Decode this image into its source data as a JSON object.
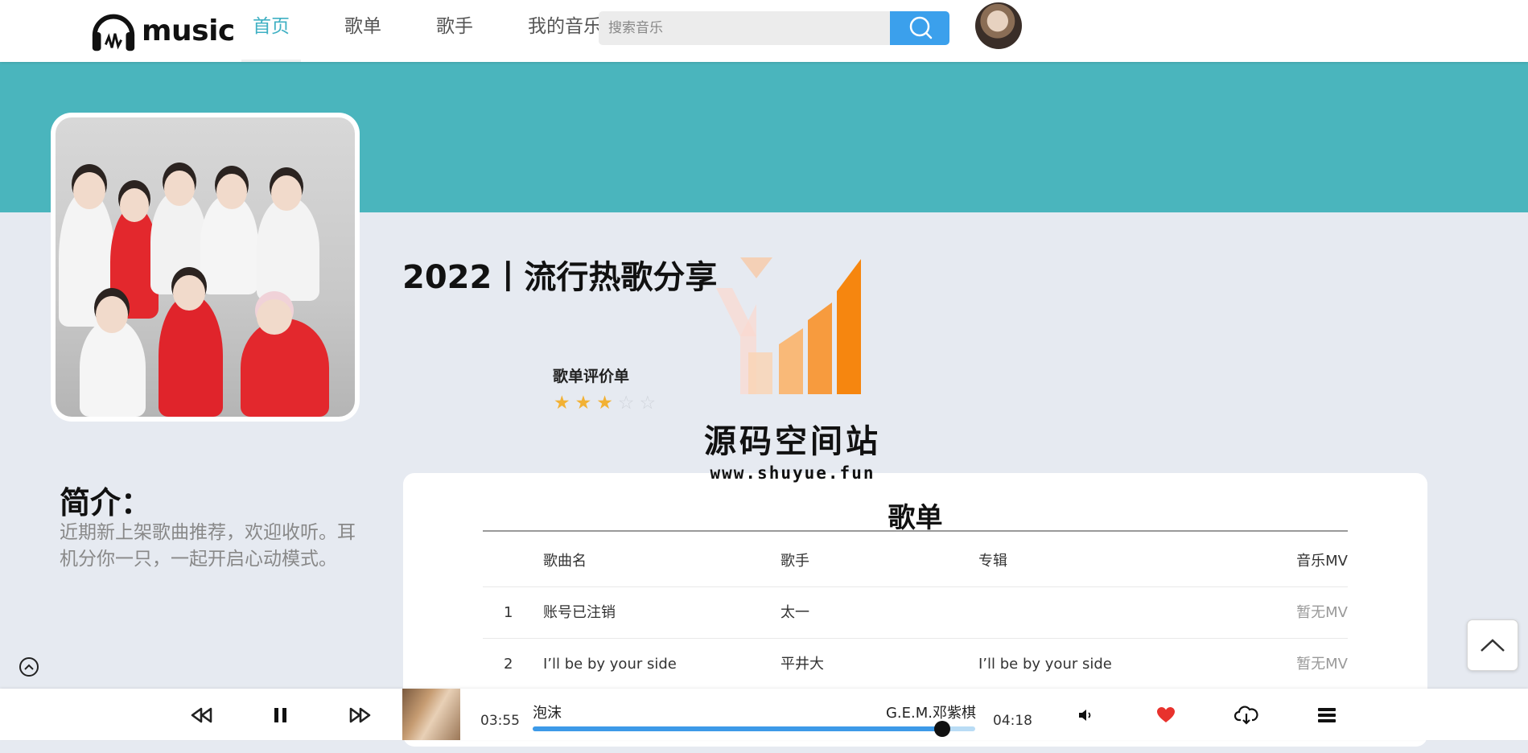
{
  "header": {
    "logo_text": "music",
    "nav": [
      "首页",
      "歌单",
      "歌手",
      "我的音乐"
    ],
    "active_nav": 0,
    "search_placeholder": "搜索音乐"
  },
  "playlist": {
    "title": "2022丨流行热歌分享",
    "rating_label": "歌单评价单",
    "rating": 3,
    "rating_max": 5
  },
  "watermark": {
    "title": "源码空间站",
    "url": "www.shuyue.fun"
  },
  "intro": {
    "heading": "简介：",
    "text": "近期新上架歌曲推荐，欢迎收听。耳机分你一只，一起开启心动模式。"
  },
  "song_list": {
    "title": "歌单",
    "columns": [
      "歌曲名",
      "歌手",
      "专辑",
      "音乐MV"
    ],
    "rows": [
      {
        "index": "1",
        "name": "账号已注销",
        "artist": "太一",
        "album": "",
        "mv": "暂无MV"
      },
      {
        "index": "2",
        "name": "I’ll be by your side",
        "artist": "平井大",
        "album": "I’ll be by your side",
        "mv": "暂无MV"
      }
    ]
  },
  "player": {
    "current_time": "03:55",
    "song": "泡沫",
    "artist": "G.E.M.邓紫棋",
    "total_time": "04:18",
    "progress": 0.926,
    "colors": {
      "progress": "#3d9ae8",
      "track": "#b9dcf5",
      "heart": "#e8322d"
    }
  },
  "colors": {
    "accent": "#3fb0c3",
    "banner": "#4ab5bd",
    "search_button": "#3ba0ec"
  }
}
